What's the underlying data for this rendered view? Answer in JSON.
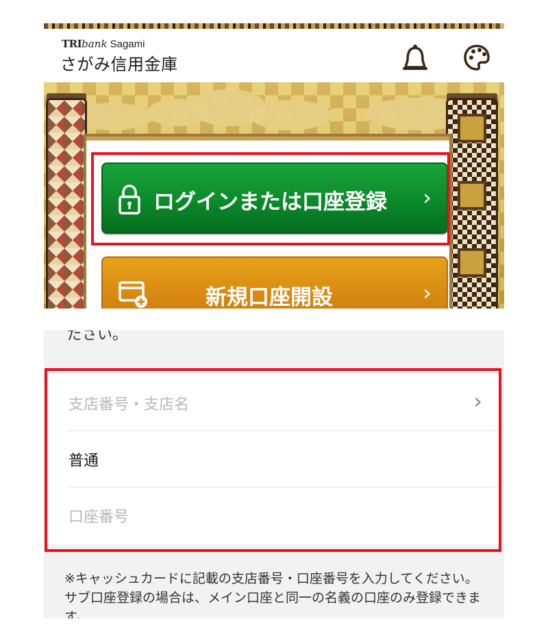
{
  "header": {
    "brand_tri": "TRI",
    "brand_bank": "bank",
    "brand_sagami": " Sagami",
    "bank_name": "さがみ信用金庫"
  },
  "icons": {
    "notification": "bell-icon",
    "theme": "palette-icon",
    "lock": "lock-icon",
    "card_add": "card-add-icon"
  },
  "main": {
    "login_button": "ログインまたは口座登録",
    "open_account_button": "新規口座開設",
    "chevron": "›"
  },
  "account_form": {
    "cut_off_text": "ださい。",
    "branch_placeholder": "支店番号・支店名",
    "branch_chevron": "›",
    "account_type": "普通",
    "account_number_placeholder": "口座番号",
    "note": "※キャッシュカードに記載の支店番号・口座番号を入力してください。サブ口座登録の場合は、メイン口座と同一の名義の口座のみ登録できます。"
  },
  "colors": {
    "login_green": "#0b8a2b",
    "open_orange": "#d98a12",
    "highlight_red": "#e8121c"
  }
}
